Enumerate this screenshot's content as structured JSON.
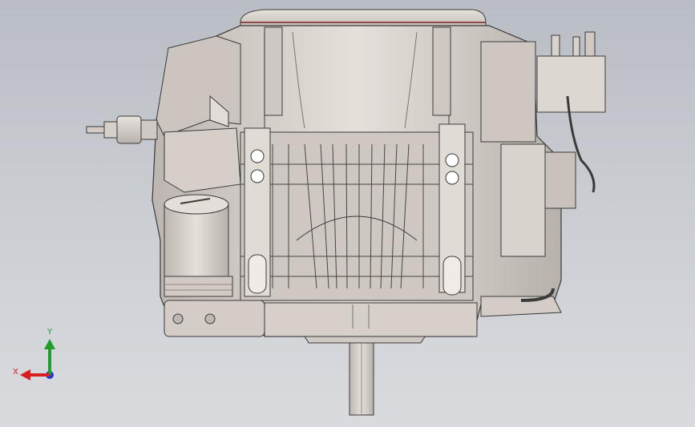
{
  "viewport": {
    "background_top": "#b9bdc4",
    "background_bottom": "#d9dbdf"
  },
  "model": {
    "icon": "engine-cad-model",
    "body_color": "#d8d2cd",
    "edge_color": "#3a3a3a",
    "accent_color": "#7a1f1f"
  },
  "triad": {
    "x_label": "X",
    "y_label": "Y",
    "x_color": "#d81e1e",
    "y_color": "#1f9e2a",
    "z_color": "#2436d6"
  }
}
